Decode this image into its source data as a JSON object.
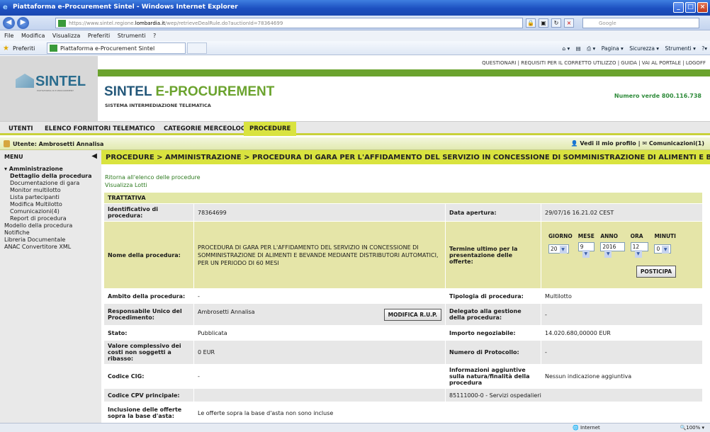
{
  "window": {
    "title": "Piattaforma e-Procurement Sintel - Windows Internet Explorer"
  },
  "browser": {
    "url_prefix": "https://www.sintel.regione.",
    "url_domain": "lombardia.it",
    "url_suffix": "/wep/retrieveDealRule.do?auctionId=78364699",
    "search_placeholder": "Google",
    "menu": [
      "File",
      "Modifica",
      "Visualizza",
      "Preferiti",
      "Strumenti",
      "?"
    ],
    "favorites_label": "Preferiti",
    "tab_title": "Piattaforma e-Procurement Sintel",
    "commands": [
      "Pagina ▾",
      "Sicurezza ▾",
      "Strumenti ▾"
    ]
  },
  "site": {
    "logo_text": "SINTEL",
    "logo_sub": "PIATTAFORMA DI E-PROCUREMENT",
    "top_links": "QUESTIONARI | REQUISITI PER IL CORRETTO UTILIZZO | GUIDA | VAI AL PORTALE | LOGOFF",
    "brand_a": "SINTEL ",
    "brand_b": "E-PROCUREMENT",
    "brand_sub": "SISTEMA INTERMEDIAZIONE TELEMATICA",
    "phone": "Numero verde 800.116.738"
  },
  "tabs": [
    "UTENTI",
    "ELENCO FORNITORI TELEMATICO",
    "CATEGORIE MERCEOLOGICHE",
    "PROCEDURE"
  ],
  "userbar": {
    "user": "Utente: Ambrosetti Annalisa",
    "profile": "Vedi il mio profilo",
    "comms": "Comunicazioni(1)"
  },
  "sidebar": {
    "title": "MENU",
    "items": [
      {
        "label": "▾ Amministrazione",
        "bold": true,
        "level": 1
      },
      {
        "label": "Dettaglio della procedura",
        "bold": true,
        "level": 2
      },
      {
        "label": "Documentazione di gara",
        "level": 2
      },
      {
        "label": "Monitor multilotto",
        "level": 2
      },
      {
        "label": "Lista partecipanti",
        "level": 2
      },
      {
        "label": "Modifica Multilotto",
        "level": 2
      },
      {
        "label": "Comunicazioni(4)",
        "level": 2
      },
      {
        "label": "Report di procedura",
        "level": 2
      },
      {
        "label": "Modello della procedura",
        "level": 1
      },
      {
        "label": "Notifiche",
        "level": 1
      },
      {
        "label": "Libreria Documentale",
        "level": 1
      },
      {
        "label": "ANAC Convertitore XML",
        "level": 1
      }
    ]
  },
  "breadcrumb": "PROCEDURE  > AMMINISTRAZIONE  > PROCEDURA DI GARA PER L'AFFIDAMENTO DEL SERVIZIO IN CONCESSIONE DI SOMMINISTRAZIONE DI ALIMENTI E BE...",
  "links": {
    "back": "Ritorna all'elenco delle procedure",
    "lotti": "Visualizza Lotti"
  },
  "section": "TRATTATIVA",
  "fields": {
    "id_label": "Identificativo di procedura:",
    "id_value": "78364699",
    "apertura_label": "Data apertura:",
    "apertura_value": "29/07/16 16.21.02 CEST",
    "nome_label": "Nome della procedura:",
    "nome_value": "PROCEDURA DI GARA PER L'AFFIDAMENTO DEL SERVIZIO IN CONCESSIONE DI SOMMINISTRAZIONE DI ALIMENTI E BEVANDE MEDIANTE DISTRIBUTORI AUTOMATICI, PER UN PERIODO DI 60 MESI",
    "termine_label": "Termine ultimo per la presentazione delle offerte:",
    "termine_cols": [
      "GIORNO",
      "MESE",
      "ANNO",
      "ORA",
      "MINUTI"
    ],
    "termine_values": [
      "20",
      "9",
      "2016",
      "12",
      "0"
    ],
    "posticipa": "POSTICIPA",
    "ambito_label": "Ambito della procedura:",
    "ambito_value": "-",
    "tipologia_label": "Tipologia di procedura:",
    "tipologia_value": "Multilotto",
    "rup_label": "Responsabile Unico del Procedimento:",
    "rup_value": "Ambrosetti Annalisa",
    "rup_button": "MODIFICA R.U.P.",
    "delegato_label": "Delegato alla gestione della procedura:",
    "delegato_value": "-",
    "stato_label": "Stato:",
    "stato_value": "Pubblicata",
    "importo_label": "Importo negoziabile:",
    "importo_value": "14.020.680,00000 EUR",
    "costi_label": "Valore complessivo dei costi non soggetti a ribasso:",
    "costi_value": "0 EUR",
    "protocollo_label": "Numero di Protocollo:",
    "protocollo_value": "-",
    "cig_label": "Codice CIG:",
    "cig_value": "-",
    "info_label": "Informazioni aggiuntive sulla natura/finalità della procedura",
    "info_value": "Nessun indicazione aggiuntiva",
    "cpv_label": "Codice CPV principale:",
    "cpv_value": "85111000-0 - Servizi ospedalieri",
    "incl_label": "Inclusione delle offerte sopra la base d'asta:",
    "incl_value": "Le offerte sopra la base d'asta non sono incluse"
  },
  "status": {
    "zone": "Internet",
    "zoom": "100%"
  }
}
